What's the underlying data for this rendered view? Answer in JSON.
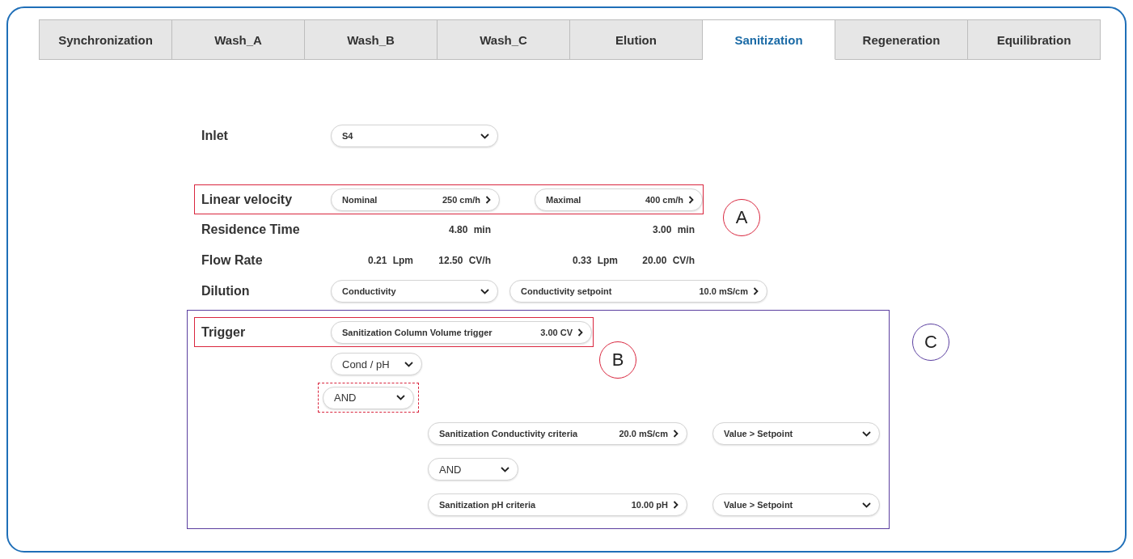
{
  "tabs": [
    {
      "label": "Synchronization",
      "selected": false
    },
    {
      "label": "Wash_A",
      "selected": false
    },
    {
      "label": "Wash_B",
      "selected": false
    },
    {
      "label": "Wash_C",
      "selected": false
    },
    {
      "label": "Elution",
      "selected": false
    },
    {
      "label": "Sanitization",
      "selected": true
    },
    {
      "label": "Regeneration",
      "selected": false
    },
    {
      "label": "Equilibration",
      "selected": false
    }
  ],
  "form": {
    "inlet": {
      "label": "Inlet",
      "value": "S4"
    },
    "linear_velocity": {
      "label": "Linear velocity",
      "nominal": {
        "label": "Nominal",
        "value": "250 cm/h"
      },
      "maximal": {
        "label": "Maximal",
        "value": "400 cm/h"
      }
    },
    "residence_time": {
      "label": "Residence Time",
      "values": [
        "4.80 min",
        "3.00 min"
      ]
    },
    "flow_rate": {
      "label": "Flow Rate",
      "values": [
        "0.21 Lpm",
        "12.50 CV/h",
        "0.33 Lpm",
        "20.00 CV/h"
      ]
    },
    "dilution": {
      "label": "Dilution",
      "mode": "Conductivity",
      "setpoint": {
        "label": "Conductivity setpoint",
        "value": "10.0 mS/cm"
      }
    },
    "trigger": {
      "label": "Trigger",
      "volume": {
        "label": "Sanitization Column Volume trigger",
        "value": "3.00 CV"
      },
      "criteria_type": "Cond / pH",
      "logic": "AND",
      "criteria": [
        {
          "label": "Sanitization Conductivity criteria",
          "value": "20.0 mS/cm",
          "comparison": "Value > Setpoint"
        },
        {
          "label": "Sanitization pH criteria",
          "value": "10.00 pH",
          "comparison": "Value > Setpoint"
        }
      ],
      "criteria_logic": "AND"
    }
  },
  "annotations": [
    {
      "letter": "A",
      "color": "#d9263e"
    },
    {
      "letter": "B",
      "color": "#d9263e"
    },
    {
      "letter": "C",
      "color": "#5b3fa0"
    }
  ]
}
